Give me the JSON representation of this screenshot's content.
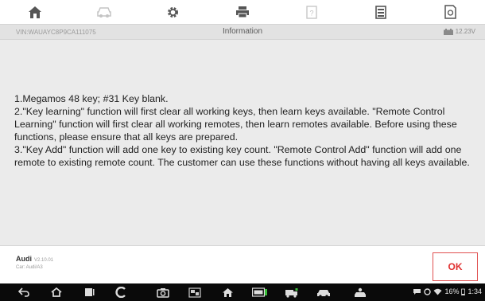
{
  "toolbar": {
    "items": [
      {
        "icon": "home-icon"
      },
      {
        "icon": "car-icon"
      },
      {
        "icon": "gear-icon"
      },
      {
        "icon": "print-icon"
      },
      {
        "icon": "help-icon"
      },
      {
        "icon": "data-icon"
      },
      {
        "icon": "screenshot-icon"
      }
    ]
  },
  "infobar": {
    "vin": "VIN:WAUAYC8P9CA111075",
    "title": "Information",
    "voltage": "12.23V"
  },
  "message": {
    "lines": [
      "1.Megamos 48 key; #31 Key blank.",
      "2.\"Key learning\" function will first clear all working keys, then learn keys available. \"Remote Control Learning\" function will first clear all working remotes, then learn remotes available. Before using these functions, please ensure that all keys are prepared.",
      "3.\"Key Add\" function will add one key to existing key count. \"Remote Control Add\" function will add one remote to existing remote count. The customer can use these functions without having all keys available."
    ]
  },
  "footer": {
    "brand": "Audi",
    "version": "V2.10.01",
    "car": "Car: Audi/A3",
    "ok_label": "OK"
  },
  "status": {
    "battery": "16%",
    "time": "1:34"
  },
  "colors": {
    "accent": "#e03030",
    "toolbar_icon": "#555555",
    "navbar_bg": "#0a0a0a"
  }
}
